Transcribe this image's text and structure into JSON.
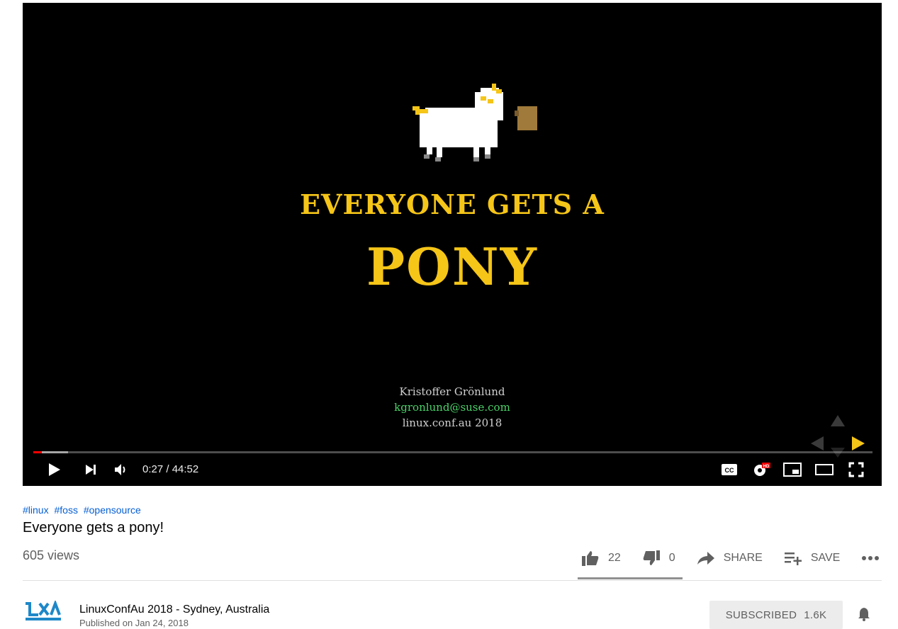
{
  "video": {
    "slide": {
      "headline": "EVERYONE GETS A",
      "headline_big": "PONY",
      "author": "Kristoffer Grönlund",
      "email": "kgronlund@suse.com",
      "event": "linux.conf.au 2018"
    },
    "controls": {
      "current_time": "0:27",
      "duration": "44:52",
      "time_display": "0:27 / 44:52",
      "progress_played_fraction": 0.01,
      "progress_buffered_fraction": 0.041
    },
    "icons": [
      "play-icon",
      "next-icon",
      "volume-icon",
      "captions-icon",
      "settings-hd-icon",
      "miniplayer-icon",
      "theater-icon",
      "fullscreen-icon"
    ]
  },
  "info": {
    "hashtags": [
      "#linux",
      "#foss",
      "#opensource"
    ],
    "title": "Everyone gets a pony!",
    "views": "605 views",
    "likes": "22",
    "dislikes": "0",
    "share_label": "SHARE",
    "save_label": "SAVE",
    "like_ratio": 1.0
  },
  "channel": {
    "name": "LinuxConfAu 2018 - Sydney, Australia",
    "published": "Published on Jan 24, 2018",
    "subscribe_label": "SUBSCRIBED",
    "subscriber_count": "1.6K"
  },
  "colors": {
    "accent_red": "#ff0000",
    "link_blue": "#065fd4",
    "slide_yellow": "#f5c518",
    "slide_green": "#4cd26a"
  }
}
